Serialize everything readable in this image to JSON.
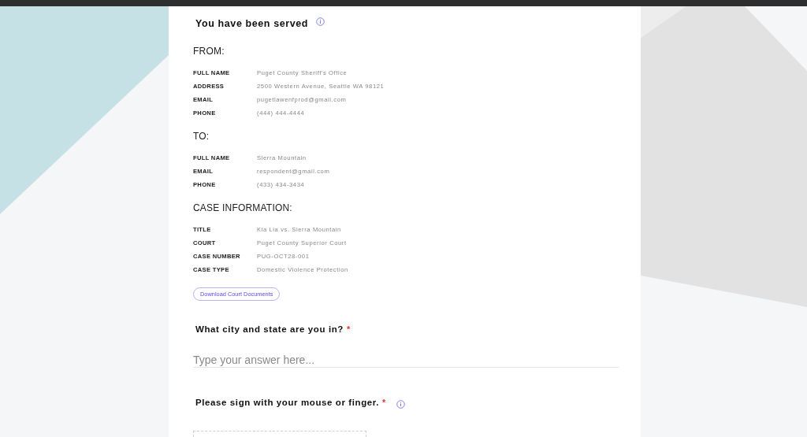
{
  "form": {
    "title": "You have been served",
    "sections": [
      {
        "heading": "FROM:",
        "fields": [
          {
            "label": "FULL NAME",
            "value": "Puget County Sheriff's Office"
          },
          {
            "label": "ADDRESS",
            "value": "2500 Western Avenue, Seattle WA 98121"
          },
          {
            "label": "EMAIL",
            "value": "pugetlawenfprod@gmail.com"
          },
          {
            "label": "PHONE",
            "value": "(444) 444-4444"
          }
        ]
      },
      {
        "heading": "TO:",
        "fields": [
          {
            "label": "FULL NAME",
            "value": "Sierra Mountain"
          },
          {
            "label": "EMAIL",
            "value": "respondent@gmail.com"
          },
          {
            "label": "PHONE",
            "value": "(433) 434-3434"
          }
        ]
      },
      {
        "heading": "CASE INFORMATION:",
        "fields": [
          {
            "label": "TITLE",
            "value": "Kia Lia vs. Sierra Mountain"
          },
          {
            "label": "COURT",
            "value": "Puget County Superior Court"
          },
          {
            "label": "CASE NUMBER",
            "value": "PUG-OCT28-001"
          },
          {
            "label": "CASE TYPE",
            "value": "Domestic Violence Protection"
          }
        ]
      }
    ],
    "download_button": "Download Court Documents",
    "questions": [
      {
        "kind": "text",
        "label": "What city and state are you in?",
        "required_mark": "*",
        "has_info": false,
        "placeholder": "Type your answer here..."
      },
      {
        "kind": "signature",
        "label": "Please sign with your mouse or finger.",
        "required_mark": "*",
        "has_info": true
      }
    ]
  }
}
